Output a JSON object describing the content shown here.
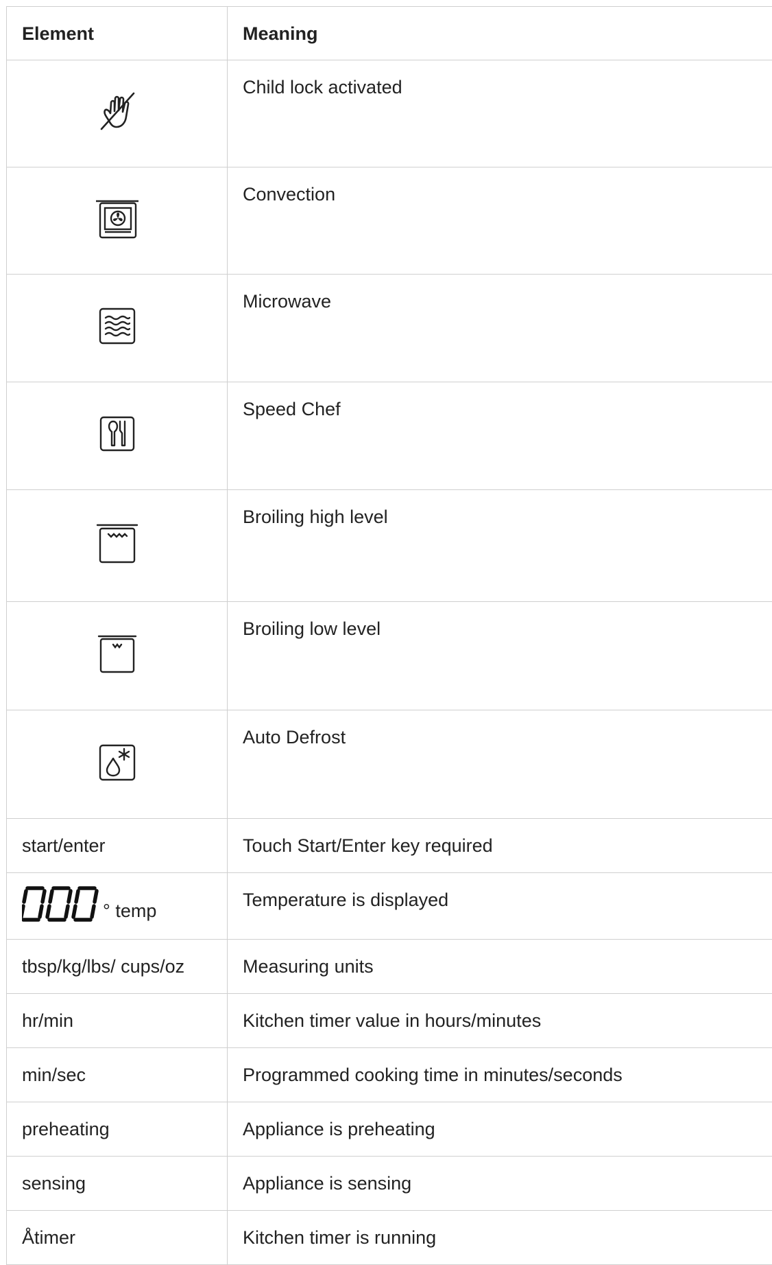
{
  "table": {
    "headers": {
      "element": "Element",
      "meaning": "Meaning"
    },
    "icon_rows": [
      {
        "icon": "child-lock-hand-icon",
        "meaning": "Child lock activated"
      },
      {
        "icon": "convection-fan-icon",
        "meaning": "Convection"
      },
      {
        "icon": "microwave-waves-icon",
        "meaning": "Microwave"
      },
      {
        "icon": "speed-chef-cutlery-icon",
        "meaning": "Speed Chef"
      },
      {
        "icon": "broil-high-icon",
        "meaning": "Broiling high level"
      },
      {
        "icon": "broil-low-icon",
        "meaning": "Broiling low level"
      },
      {
        "icon": "auto-defrost-icon",
        "meaning": "Auto Defrost"
      }
    ],
    "start_row": {
      "element": "start/enter",
      "meaning": "Touch Start/Enter key required"
    },
    "temp_row": {
      "digits": "000",
      "degree": "°",
      "label": "temp",
      "meaning": "Temperature is displayed"
    },
    "text_rows": [
      {
        "element": "tbsp/kg/lbs/ cups/oz",
        "meaning": "Measuring units"
      },
      {
        "element": "hr/min",
        "meaning": "Kitchen timer value in hours/minutes"
      },
      {
        "element": "min/sec",
        "meaning": "Programmed cooking time in minutes/seconds"
      },
      {
        "element": "preheating",
        "meaning": "Appliance is preheating"
      },
      {
        "element": "sensing",
        "meaning": "Appliance is sensing"
      },
      {
        "element": "Åtimer",
        "meaning": "Kitchen timer is running"
      }
    ]
  }
}
